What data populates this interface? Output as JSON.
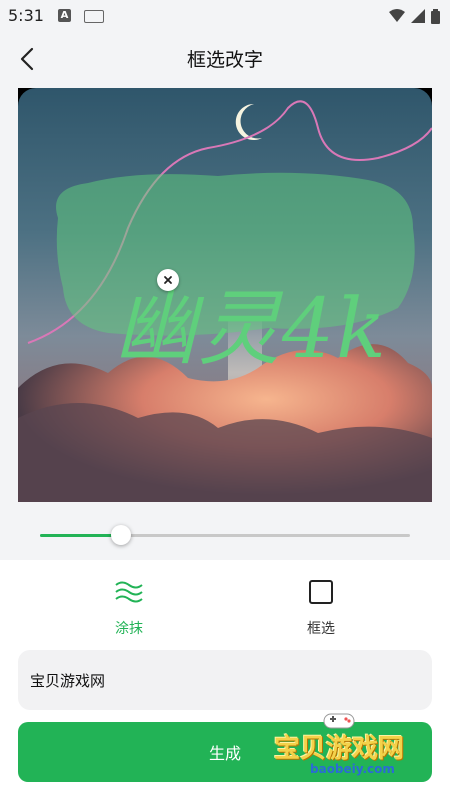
{
  "status_bar": {
    "time": "5:31",
    "a_icon_letter": "A"
  },
  "header": {
    "title": "框选改字",
    "back_icon": "chevron-left-icon"
  },
  "canvas": {
    "overlay_text": "幽灵4k",
    "mask_color": "#5fcf7c",
    "close_icon": "close-icon"
  },
  "slider": {
    "value": 0.22,
    "fill_color": "#22b356"
  },
  "tools": {
    "smear": {
      "label": "涂抹",
      "icon": "waves-icon",
      "selected": true
    },
    "box": {
      "label": "框选",
      "icon": "square-icon",
      "selected": false
    }
  },
  "input": {
    "value": "宝贝游戏网"
  },
  "generate_button": {
    "label": "生成"
  },
  "watermark": {
    "title": "宝贝游戏网",
    "url": "baobeiy.com"
  },
  "colors": {
    "accent": "#22b356",
    "background": "#f3f4f6"
  }
}
